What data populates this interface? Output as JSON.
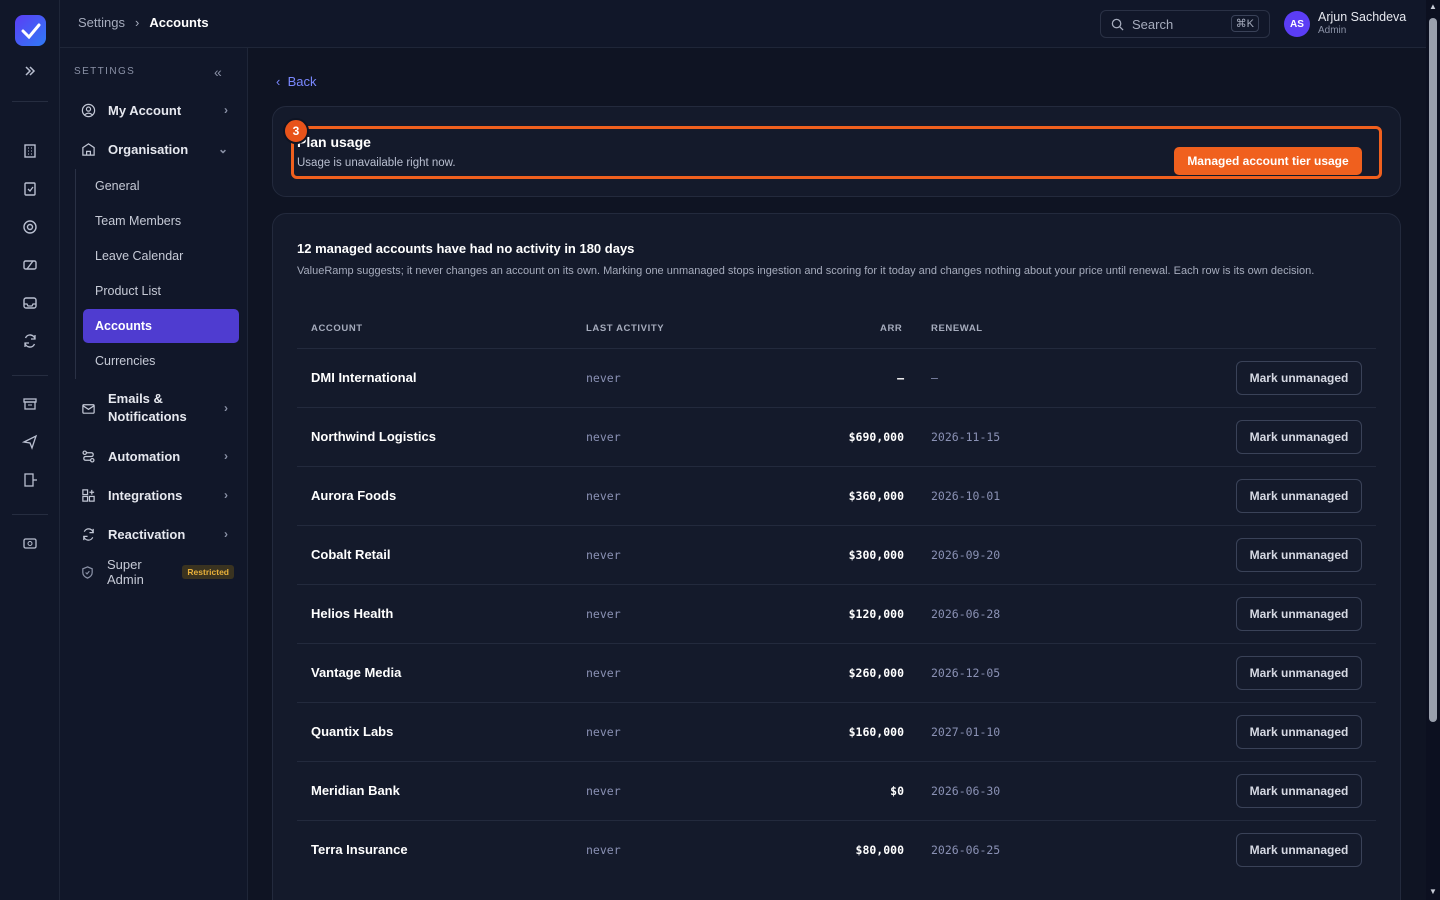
{
  "breadcrumb": {
    "root": "Settings",
    "current": "Accounts"
  },
  "search": {
    "label": "Search",
    "shortcut": "⌘K"
  },
  "user": {
    "initials": "AS",
    "name": "Arjun Sachdeva",
    "role": "Admin"
  },
  "sidebar": {
    "header": "SETTINGS",
    "my_account": "My Account",
    "organisation": "Organisation",
    "sub_items": [
      "General",
      "Team Members",
      "Leave Calendar",
      "Product List",
      "Accounts",
      "Currencies"
    ],
    "emails_line1": "Emails &",
    "emails_line2": "Notifications",
    "automation": "Automation",
    "integrations": "Integrations",
    "reactivation": "Reactivation",
    "super_admin": "Super Admin",
    "restricted_badge": "Restricted"
  },
  "main": {
    "back_label": "Back",
    "plan": {
      "step_number": "3",
      "title": "Plan usage",
      "subtitle": "Usage is unavailable right now.",
      "button": "Managed account tier usage"
    },
    "inactive": {
      "title": "12 managed accounts have had no activity in 180 days",
      "description": "ValueRamp suggests; it never changes an account on its own. Marking one unmanaged stops ingestion and scoring for it today and changes nothing about your price until renewal. Each row is its own decision.",
      "columns": {
        "account": "ACCOUNT",
        "last_activity": "LAST ACTIVITY",
        "arr": "ARR",
        "renewal": "RENEWAL"
      },
      "action_label": "Mark unmanaged",
      "rows": [
        {
          "account": "DMI International",
          "last_activity": "never",
          "arr": "—",
          "renewal": "—"
        },
        {
          "account": "Northwind Logistics",
          "last_activity": "never",
          "arr": "$690,000",
          "renewal": "2026-11-15"
        },
        {
          "account": "Aurora Foods",
          "last_activity": "never",
          "arr": "$360,000",
          "renewal": "2026-10-01"
        },
        {
          "account": "Cobalt Retail",
          "last_activity": "never",
          "arr": "$300,000",
          "renewal": "2026-09-20"
        },
        {
          "account": "Helios Health",
          "last_activity": "never",
          "arr": "$120,000",
          "renewal": "2026-06-28"
        },
        {
          "account": "Vantage Media",
          "last_activity": "never",
          "arr": "$260,000",
          "renewal": "2026-12-05"
        },
        {
          "account": "Quantix Labs",
          "last_activity": "never",
          "arr": "$160,000",
          "renewal": "2027-01-10"
        },
        {
          "account": "Meridian Bank",
          "last_activity": "never",
          "arr": "$0",
          "renewal": "2026-06-30"
        },
        {
          "account": "Terra Insurance",
          "last_activity": "never",
          "arr": "$80,000",
          "renewal": "2026-06-25"
        }
      ]
    }
  }
}
